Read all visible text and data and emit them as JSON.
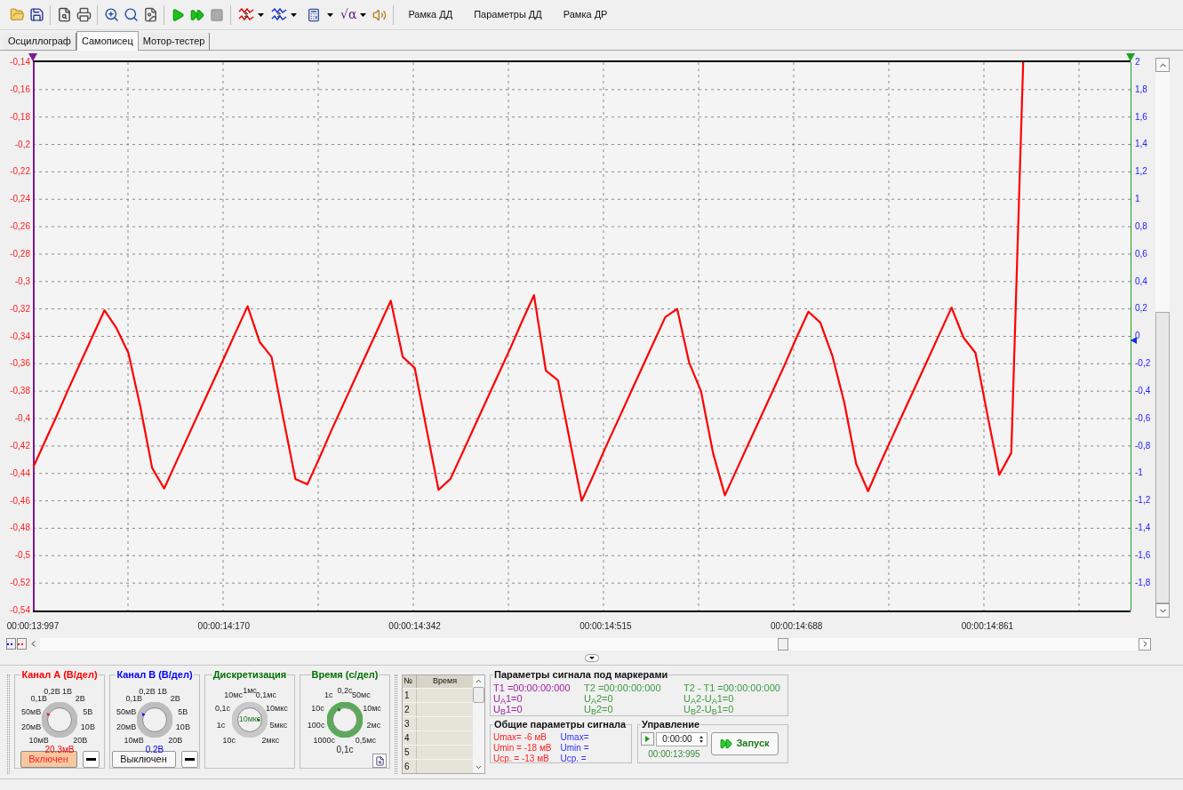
{
  "toolbar": {
    "formula_symbol": "√α",
    "stop_disabled": true,
    "buttons": [
      "Рамка ДД",
      "Параметры ДД",
      "Рамка ДР"
    ]
  },
  "tabs": [
    {
      "label": "Осциллограф",
      "selected": false
    },
    {
      "label": "Самописец",
      "selected": true
    },
    {
      "label": "Мотор-тестер",
      "selected": false
    }
  ],
  "chart": {
    "chart_data": {
      "type": "line",
      "grid": true,
      "ylim": [
        -0.54,
        -0.14
      ],
      "categories": [
        "00:00:13:997",
        null,
        null,
        null,
        null,
        null,
        null,
        null,
        null,
        null,
        null,
        null,
        null,
        null,
        null,
        null,
        "00:00:14:170",
        null,
        null,
        null,
        null,
        null,
        null,
        null,
        null,
        null,
        null,
        null,
        null,
        null,
        null,
        null,
        "00:00:14:342",
        null,
        null,
        null,
        null,
        null,
        null,
        null,
        null,
        null,
        null,
        null,
        null,
        null,
        null,
        null,
        "00:00:14:515",
        null,
        null,
        null,
        null,
        null,
        null,
        null,
        null,
        null,
        null,
        null,
        null,
        null,
        null,
        null,
        "00:00:14:688",
        null,
        null,
        null,
        null,
        null,
        null,
        null,
        null,
        null,
        null,
        null,
        null,
        null,
        null,
        null,
        "00:00:14:861",
        null,
        null,
        null,
        null,
        null,
        null,
        null,
        null,
        null,
        null,
        null,
        null
      ],
      "yticks": [
        {
          "value": -0.14,
          "label": "-0,14"
        },
        {
          "value": -0.16,
          "label": "-0,16"
        },
        {
          "value": -0.18,
          "label": "-0,18"
        },
        {
          "value": -0.2,
          "label": "-0,2"
        },
        {
          "value": -0.22,
          "label": "-0,22"
        },
        {
          "value": -0.24,
          "label": "-0,24"
        },
        {
          "value": -0.26,
          "label": "-0,26"
        },
        {
          "value": -0.28,
          "label": "-0,28"
        },
        {
          "value": -0.3,
          "label": "-0,3"
        },
        {
          "value": -0.32,
          "label": "-0,32"
        },
        {
          "value": -0.34,
          "label": "-0,34"
        },
        {
          "value": -0.36,
          "label": "-0,36"
        },
        {
          "value": -0.38,
          "label": "-0,38"
        },
        {
          "value": -0.4,
          "label": "-0,4"
        },
        {
          "value": -0.42,
          "label": "-0,42"
        },
        {
          "value": -0.44,
          "label": "-0,44"
        },
        {
          "value": -0.46,
          "label": "-0,46"
        },
        {
          "value": -0.48,
          "label": "-0,48"
        },
        {
          "value": -0.5,
          "label": "-0,5"
        },
        {
          "value": -0.52,
          "label": "-0,52"
        },
        {
          "value": -0.54,
          "label": "-0,54"
        }
      ],
      "series": [
        {
          "color": "#ff0000",
          "values": [
            -0.436,
            -0.417,
            -0.398,
            -0.378,
            -0.359,
            -0.34,
            -0.321,
            -0.334,
            -0.352,
            -0.391,
            -0.436,
            -0.451,
            -0.432,
            -0.413,
            -0.394,
            -0.375,
            -0.356,
            -0.337,
            -0.318,
            -0.344,
            -0.355,
            -0.4,
            -0.444,
            -0.448,
            -0.429,
            -0.409,
            -0.39,
            -0.371,
            -0.352,
            -0.333,
            -0.314,
            -0.355,
            -0.363,
            -0.408,
            -0.452,
            -0.444,
            -0.425,
            -0.406,
            -0.387,
            -0.368,
            -0.349,
            -0.329,
            -0.31,
            -0.365,
            -0.372,
            -0.416,
            -0.46,
            -0.441,
            -0.421,
            -0.402,
            -0.383,
            -0.364,
            -0.345,
            -0.326,
            -0.32,
            -0.359,
            -0.38,
            -0.425,
            -0.456,
            -0.437,
            -0.418,
            -0.399,
            -0.38,
            -0.361,
            -0.341,
            -0.322,
            -0.33,
            -0.354,
            -0.388,
            -0.433,
            -0.453,
            -0.433,
            -0.414,
            -0.395,
            -0.376,
            -0.357,
            -0.338,
            -0.319,
            -0.341,
            -0.352,
            -0.397,
            -0.441,
            -0.425,
            -0.14,
            null,
            null,
            null,
            null,
            null,
            null,
            null,
            null,
            null
          ]
        }
      ]
    },
    "right_ticks": [
      "2",
      "1,8",
      "1,6",
      "1,4",
      "1,2",
      "1",
      "0,8",
      "0,6",
      "0,4",
      "0,2",
      "0",
      "-0,2",
      "-0,4",
      "-0,6",
      "-0,8",
      "-1",
      "-1,2",
      "-1,4",
      "-1,6",
      "-1,8"
    ]
  },
  "dials": [
    {
      "kind": "channel",
      "title": "Канал А (В/дел)",
      "color": "#ff0000",
      "labels": [
        "10мВ",
        "20мВ",
        "50мВ",
        "0,1В",
        "0,2В",
        "1В",
        "2В",
        "5В",
        "10В",
        "20В"
      ],
      "reading": "20.3мВ",
      "button": {
        "label": "Включен",
        "on": true
      }
    },
    {
      "kind": "channel",
      "title": "Канал В (В/дел)",
      "color": "#0000ff",
      "labels": [
        "10мВ",
        "20мВ",
        "50мВ",
        "0,1В",
        "0,2В",
        "1В",
        "2В",
        "5В",
        "10В",
        "20В"
      ],
      "reading": "0.2В",
      "button": {
        "label": "Выключен",
        "on": false
      }
    },
    {
      "kind": "sampling",
      "title": "Дискретизация",
      "color": "#007000",
      "labels": [
        "10с",
        "1с",
        "0,1с",
        "10мс",
        "1мс",
        "0,1мс",
        "10мкс",
        "5мкс",
        "2мкс"
      ],
      "center": "10мкс"
    },
    {
      "kind": "time",
      "title": "Время (с/дел)",
      "color": "#007000",
      "labels": [
        "1000с",
        "100с",
        "10с",
        "1с",
        "0,2с",
        "50мс",
        "10мс",
        "2мс",
        "0,5мс"
      ],
      "reading": "0,1с"
    }
  ],
  "table": {
    "columns": [
      "№",
      "Время"
    ],
    "rows": [
      "1",
      "2",
      "3",
      "4",
      "5",
      "6"
    ]
  },
  "marker_params": {
    "title": "Параметры сигнала под маркерами",
    "columns": [
      {
        "color": "#a020a0",
        "lines": [
          "T1 =00:00:00:000",
          "U$_{A}$1=0",
          "U$_{B}$1=0"
        ]
      },
      {
        "color": "#3c9a3c",
        "lines": [
          "T2 =00:00:00:000",
          "U$_{A}$2=0",
          "U$_{B}$2=0"
        ]
      },
      {
        "color": "#3c9a3c",
        "lines": [
          "T2 - T1 =00:00:00:000",
          "U$_{A}$2-U$_{A}$1=0",
          "U$_{B}$2-U$_{B}$1=0"
        ]
      }
    ]
  },
  "general_params": {
    "title": "Общие параметры сигнала",
    "columns": [
      {
        "color": "#ff2020",
        "lines": [
          "Umax= -6 мВ",
          "Umin = -18 мВ",
          "Uср. = -13 мВ"
        ]
      },
      {
        "color": "#3030ff",
        "lines": [
          "Umax=",
          "Umin =",
          "Uср. ="
        ]
      }
    ]
  },
  "control": {
    "title": "Управление",
    "time_value": "0:00:00",
    "elapsed": "00:00:13:995",
    "start_button": "Запуск"
  }
}
